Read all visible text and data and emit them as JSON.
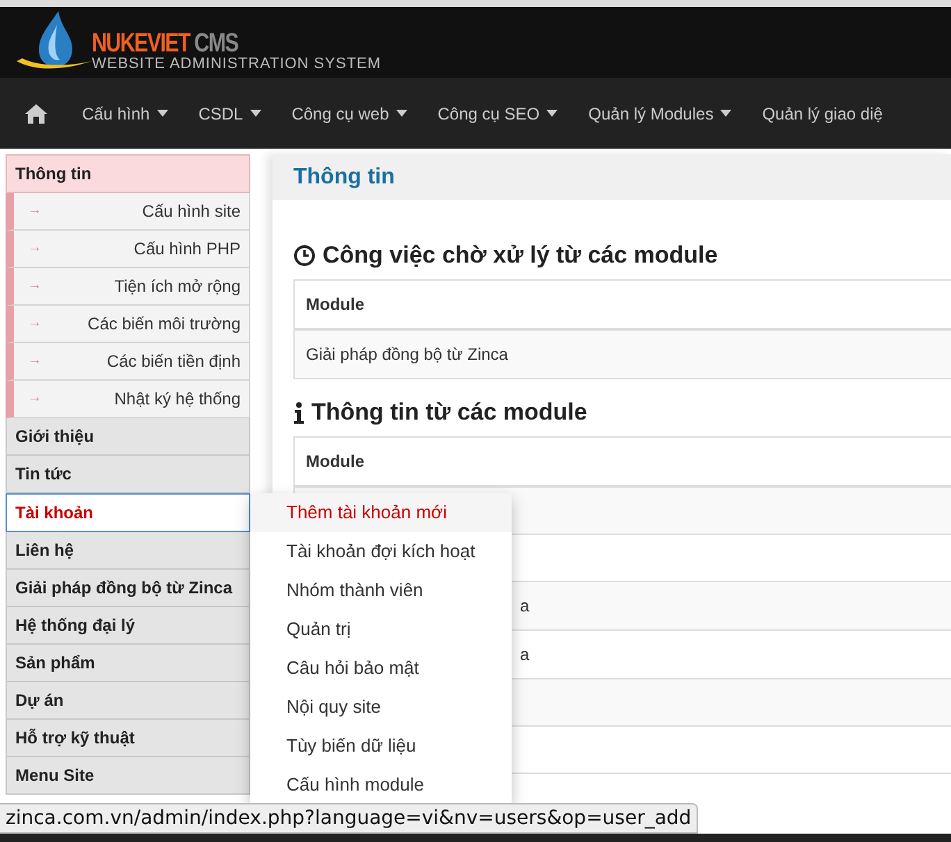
{
  "logo": {
    "brand": "NUKEVIET",
    "product": "CMS",
    "tagline": "WEBSITE ADMINISTRATION SYSTEM"
  },
  "nav": [
    {
      "label": "Cấu hình",
      "dropdown": true
    },
    {
      "label": "CSDL",
      "dropdown": true
    },
    {
      "label": "Công cụ web",
      "dropdown": true
    },
    {
      "label": "Công cụ SEO",
      "dropdown": true
    },
    {
      "label": "Quản lý Modules",
      "dropdown": true
    },
    {
      "label": "Quản lý giao diệ",
      "dropdown": false
    }
  ],
  "sidebar": {
    "items": [
      {
        "label": "Thông tin",
        "expanded": true,
        "selected": false,
        "children": [
          {
            "arrow": "→",
            "label": "Cấu hình site"
          },
          {
            "arrow": "→",
            "label": "Cấu hình PHP"
          },
          {
            "arrow": "→",
            "label": "Tiện ích mở rộng"
          },
          {
            "arrow": "→",
            "label": "Các biến môi trường"
          },
          {
            "arrow": "→",
            "label": "Các biến tiền định"
          },
          {
            "arrow": "→",
            "label": "Nhật ký hệ thống"
          }
        ]
      },
      {
        "label": "Giới thiệu",
        "expanded": false,
        "selected": false
      },
      {
        "label": "Tin tức",
        "expanded": false,
        "selected": false
      },
      {
        "label": "Tài khoản",
        "expanded": false,
        "selected": true
      },
      {
        "label": "Liên hệ",
        "expanded": false,
        "selected": false
      },
      {
        "label": "Giải pháp đồng bộ từ Zinca",
        "expanded": false,
        "selected": false
      },
      {
        "label": "Hệ thống đại lý",
        "expanded": false,
        "selected": false
      },
      {
        "label": "Sản phẩm",
        "expanded": false,
        "selected": false
      },
      {
        "label": "Dự án",
        "expanded": false,
        "selected": false
      },
      {
        "label": "Hỗ trợ kỹ thuật",
        "expanded": false,
        "selected": false
      },
      {
        "label": "Menu Site",
        "expanded": false,
        "selected": false
      }
    ]
  },
  "dropdown": {
    "items": [
      {
        "label": "Thêm tài khoản mới",
        "selected": true
      },
      {
        "label": "Tài khoản đợi kích hoạt",
        "selected": false
      },
      {
        "label": "Nhóm thành viên",
        "selected": false
      },
      {
        "label": "Quản trị",
        "selected": false
      },
      {
        "label": "Câu hỏi bảo mật",
        "selected": false
      },
      {
        "label": "Nội quy site",
        "selected": false
      },
      {
        "label": "Tùy biến dữ liệu",
        "selected": false
      },
      {
        "label": "Cấu hình module",
        "selected": false
      }
    ]
  },
  "page_title": "Thông tin",
  "sections": [
    {
      "kind": "pending",
      "title": "Công việc chờ xử lý từ các module",
      "columns": [
        "Module"
      ],
      "rows": [
        {
          "cell": "Giải pháp đồng bộ từ Zinca",
          "kind": "text"
        }
      ]
    },
    {
      "kind": "info",
      "title": "Thông tin từ các module",
      "columns": [
        "Module"
      ],
      "rows": [
        {
          "kind": "hidden"
        },
        {
          "kind": "hidden"
        },
        {
          "cell": "a",
          "kind": "fragment"
        },
        {
          "cell": "a",
          "kind": "fragment"
        },
        {
          "kind": "hidden"
        },
        {
          "kind": "hidden"
        }
      ]
    }
  ],
  "status_bar": {
    "url": "zinca.com.vn/admin/index.php?language=vi&nv=users&op=user_add"
  }
}
